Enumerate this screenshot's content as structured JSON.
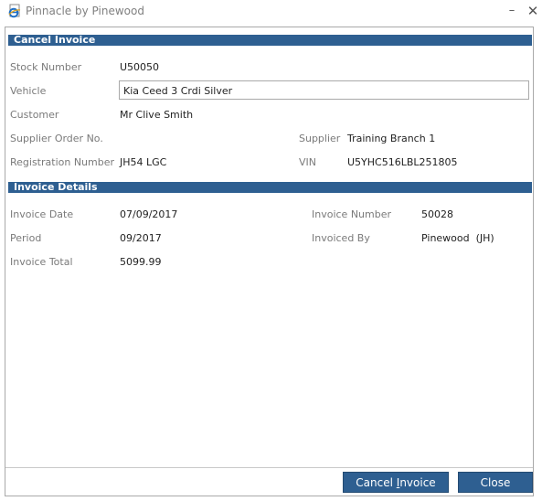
{
  "window": {
    "title": "Pinnacle by Pinewood",
    "minimize_glyph": "–",
    "close_glyph": "✕",
    "icon": "browser-app-icon"
  },
  "cancel_invoice": {
    "header": "Cancel Invoice",
    "stock_number_label": "Stock Number",
    "stock_number": "U50050",
    "vehicle_label": "Vehicle",
    "vehicle": "Kia Ceed 3 Crdi Silver",
    "customer_label": "Customer",
    "customer": "Mr Clive Smith",
    "supplier_order_label": "Supplier Order No.",
    "supplier_order": "",
    "supplier_label": "Supplier",
    "supplier": "Training Branch 1",
    "registration_label": "Registration Number",
    "registration": "JH54 LGC",
    "vin_label": "VIN",
    "vin": "U5YHC516LBL251805"
  },
  "invoice_details": {
    "header": "Invoice Details",
    "invoice_date_label": "Invoice Date",
    "invoice_date": "07/09/2017",
    "invoice_number_label": "Invoice Number",
    "invoice_number": "50028",
    "period_label": "Period",
    "period": "09/2017",
    "invoiced_by_label": "Invoiced By",
    "invoiced_by": "Pinewood  (JH)",
    "invoice_total_label": "Invoice Total",
    "invoice_total": "5099.99"
  },
  "buttons": {
    "cancel_invoice_prefix": "Cancel ",
    "cancel_invoice_accel": "I",
    "cancel_invoice_suffix": "nvoice",
    "close": "Close"
  },
  "colors": {
    "section_header": "#2e5f91",
    "button": "#2e5f91",
    "label": "#7a7a7a"
  }
}
